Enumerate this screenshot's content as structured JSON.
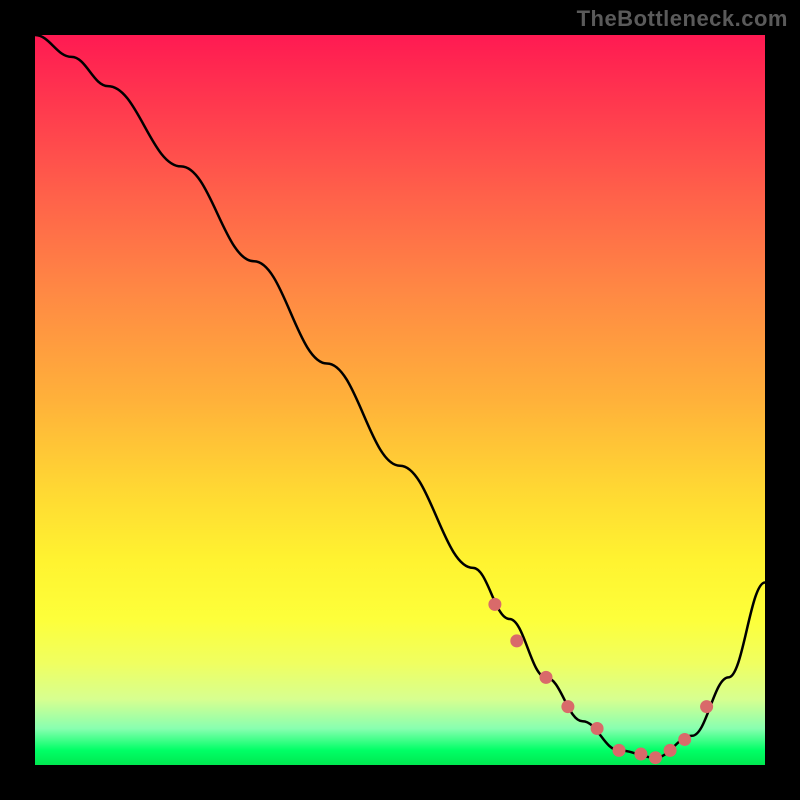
{
  "watermark": "TheBottleneck.com",
  "chart_data": {
    "type": "line",
    "title": "",
    "xlabel": "",
    "ylabel": "",
    "xlim": [
      0,
      100
    ],
    "ylim": [
      0,
      100
    ],
    "series": [
      {
        "name": "curve",
        "x": [
          0,
          5,
          10,
          20,
          30,
          40,
          50,
          60,
          65,
          70,
          75,
          80,
          85,
          90,
          95,
          100
        ],
        "y": [
          100,
          97,
          93,
          82,
          69,
          55,
          41,
          27,
          20,
          12,
          6,
          2,
          1,
          4,
          12,
          25
        ]
      },
      {
        "name": "dots",
        "x": [
          63,
          66,
          70,
          73,
          77,
          80,
          83,
          85,
          87,
          89,
          92
        ],
        "y": [
          22,
          17,
          12,
          8,
          5,
          2,
          1.5,
          1,
          2,
          3.5,
          8
        ]
      }
    ],
    "colors": {
      "curve": "#000000",
      "dots": "#d96a6a"
    }
  }
}
